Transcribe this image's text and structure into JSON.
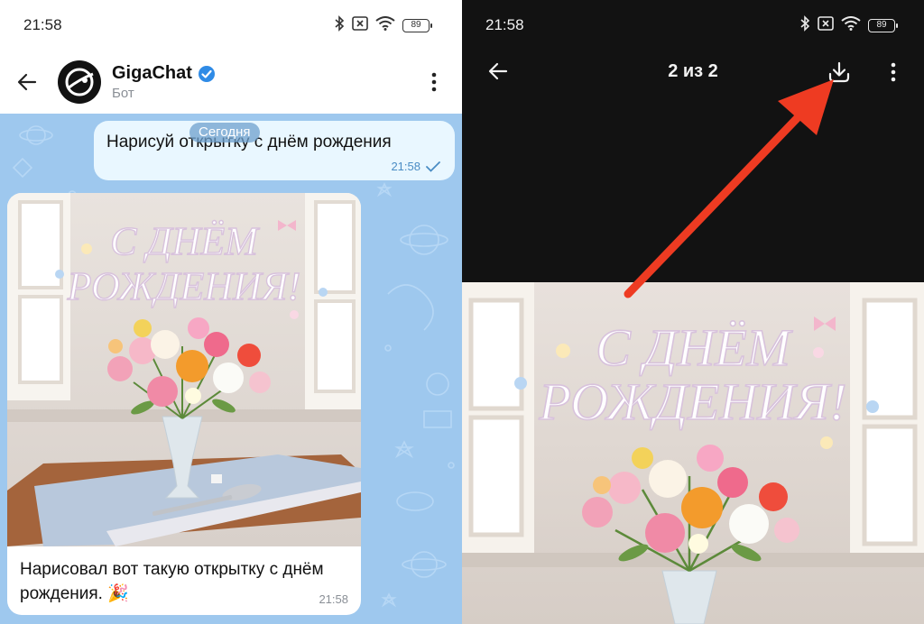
{
  "left": {
    "status": {
      "time": "21:58",
      "battery": "89"
    },
    "header": {
      "title": "GigaChat",
      "subtitle": "Бот"
    },
    "date_separator": "Сегодня",
    "outgoing": {
      "text": "Нарисуй открытку с днём рождения",
      "time": "21:58"
    },
    "incoming": {
      "image_text_line1": "С ДНЁМ",
      "image_text_line2": "РОЖДЕНИЯ!",
      "caption": "Нарисовал вот такую открытку с днём рождения. 🎉",
      "time": "21:58"
    }
  },
  "right": {
    "status": {
      "time": "21:58",
      "battery": "89"
    },
    "counter": "2 из 2",
    "image_text_line1": "С ДНЁМ",
    "image_text_line2": "РОЖДЕНИЯ!"
  },
  "colors": {
    "chat_background": "#9ec8ee",
    "outgoing_bubble": "#e9f7ff",
    "viewer_background": "#121212",
    "verified_badge": "#2f8be6",
    "annotation_arrow": "#ee3b22"
  },
  "icons": [
    "bluetooth-icon",
    "sim-off-icon",
    "wifi-icon",
    "battery-icon",
    "back-arrow-icon",
    "verified-badge-icon",
    "more-vert-icon",
    "read-check-icon",
    "download-icon",
    "party-popper-emoji"
  ]
}
